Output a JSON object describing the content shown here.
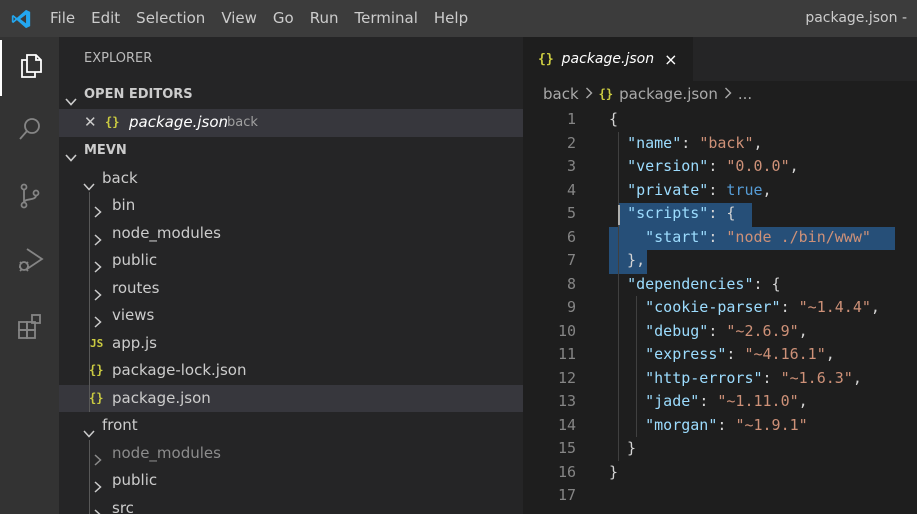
{
  "titlebar": {
    "menu": [
      "File",
      "Edit",
      "Selection",
      "View",
      "Go",
      "Run",
      "Terminal",
      "Help"
    ],
    "title": "package.json -"
  },
  "activity_bar": [
    "files-icon",
    "search-icon",
    "source-control-icon",
    "run-debug-icon",
    "extensions-icon"
  ],
  "sidebar": {
    "title": "EXPLORER",
    "open_editors": {
      "header": "OPEN EDITORS",
      "items": [
        {
          "icon": "{}",
          "name": "package.json",
          "folder": "back"
        }
      ]
    },
    "workspace": {
      "header": "MEVN",
      "tree": [
        {
          "label": "back",
          "type": "folder",
          "open": true
        },
        {
          "label": "bin",
          "type": "folder"
        },
        {
          "label": "node_modules",
          "type": "folder"
        },
        {
          "label": "public",
          "type": "folder"
        },
        {
          "label": "routes",
          "type": "folder"
        },
        {
          "label": "views",
          "type": "folder"
        },
        {
          "label": "app.js",
          "type": "file",
          "icon": "JS"
        },
        {
          "label": "package-lock.json",
          "type": "file",
          "icon": "{}"
        },
        {
          "label": "package.json",
          "type": "file",
          "icon": "{}"
        },
        {
          "label": "front",
          "type": "folder",
          "open": true
        },
        {
          "label": "node_modules",
          "type": "folder"
        },
        {
          "label": "public",
          "type": "folder"
        },
        {
          "label": "src",
          "type": "folder"
        }
      ]
    }
  },
  "editor": {
    "tab": {
      "icon": "{}",
      "label": "package.json",
      "close": "×"
    },
    "breadcrumb": {
      "folder": "back",
      "icon": "{}",
      "file": "package.json",
      "more": "..."
    },
    "lines": [
      {
        "n": "1",
        "tokens": [
          [
            "p",
            "{"
          ]
        ]
      },
      {
        "n": "2",
        "tokens": [
          [
            "p",
            "  "
          ],
          [
            "k",
            "\"name\""
          ],
          [
            "p",
            ": "
          ],
          [
            "s",
            "\"back\""
          ],
          [
            "p",
            ","
          ]
        ]
      },
      {
        "n": "3",
        "tokens": [
          [
            "p",
            "  "
          ],
          [
            "k",
            "\"version\""
          ],
          [
            "p",
            ": "
          ],
          [
            "s",
            "\"0.0.0\""
          ],
          [
            "p",
            ","
          ]
        ]
      },
      {
        "n": "4",
        "tokens": [
          [
            "p",
            "  "
          ],
          [
            "k",
            "\"private\""
          ],
          [
            "p",
            ": "
          ],
          [
            "b",
            "true"
          ],
          [
            "p",
            ","
          ]
        ]
      },
      {
        "n": "5",
        "tokens": [
          [
            "p",
            "  "
          ],
          [
            "k",
            "\"scripts\""
          ],
          [
            "p",
            ": {"
          ]
        ]
      },
      {
        "n": "6",
        "tokens": [
          [
            "p",
            "    "
          ],
          [
            "k",
            "\"start\""
          ],
          [
            "p",
            ": "
          ],
          [
            "s",
            "\"node ./bin/www\""
          ]
        ]
      },
      {
        "n": "7",
        "tokens": [
          [
            "p",
            "  },"
          ]
        ]
      },
      {
        "n": "8",
        "tokens": [
          [
            "p",
            "  "
          ],
          [
            "k",
            "\"dependencies\""
          ],
          [
            "p",
            ": {"
          ]
        ]
      },
      {
        "n": "9",
        "tokens": [
          [
            "p",
            "    "
          ],
          [
            "k",
            "\"cookie-parser\""
          ],
          [
            "p",
            ": "
          ],
          [
            "s",
            "\"~1.4.4\""
          ],
          [
            "p",
            ","
          ]
        ]
      },
      {
        "n": "10",
        "tokens": [
          [
            "p",
            "    "
          ],
          [
            "k",
            "\"debug\""
          ],
          [
            "p",
            ": "
          ],
          [
            "s",
            "\"~2.6.9\""
          ],
          [
            "p",
            ","
          ]
        ]
      },
      {
        "n": "11",
        "tokens": [
          [
            "p",
            "    "
          ],
          [
            "k",
            "\"express\""
          ],
          [
            "p",
            ": "
          ],
          [
            "s",
            "\"~4.16.1\""
          ],
          [
            "p",
            ","
          ]
        ]
      },
      {
        "n": "12",
        "tokens": [
          [
            "p",
            "    "
          ],
          [
            "k",
            "\"http-errors\""
          ],
          [
            "p",
            ": "
          ],
          [
            "s",
            "\"~1.6.3\""
          ],
          [
            "p",
            ","
          ]
        ]
      },
      {
        "n": "13",
        "tokens": [
          [
            "p",
            "    "
          ],
          [
            "k",
            "\"jade\""
          ],
          [
            "p",
            ": "
          ],
          [
            "s",
            "\"~1.11.0\""
          ],
          [
            "p",
            ","
          ]
        ]
      },
      {
        "n": "14",
        "tokens": [
          [
            "p",
            "    "
          ],
          [
            "k",
            "\"morgan\""
          ],
          [
            "p",
            ": "
          ],
          [
            "s",
            "\"~1.9.1\""
          ]
        ]
      },
      {
        "n": "15",
        "tokens": [
          [
            "p",
            "  }"
          ]
        ]
      },
      {
        "n": "16",
        "tokens": [
          [
            "p",
            "}"
          ]
        ]
      },
      {
        "n": "17",
        "tokens": []
      }
    ]
  },
  "colors": {
    "accent_blue": "#23a7f0",
    "json_icon": "#cbcb41",
    "selection": "#264f78"
  }
}
